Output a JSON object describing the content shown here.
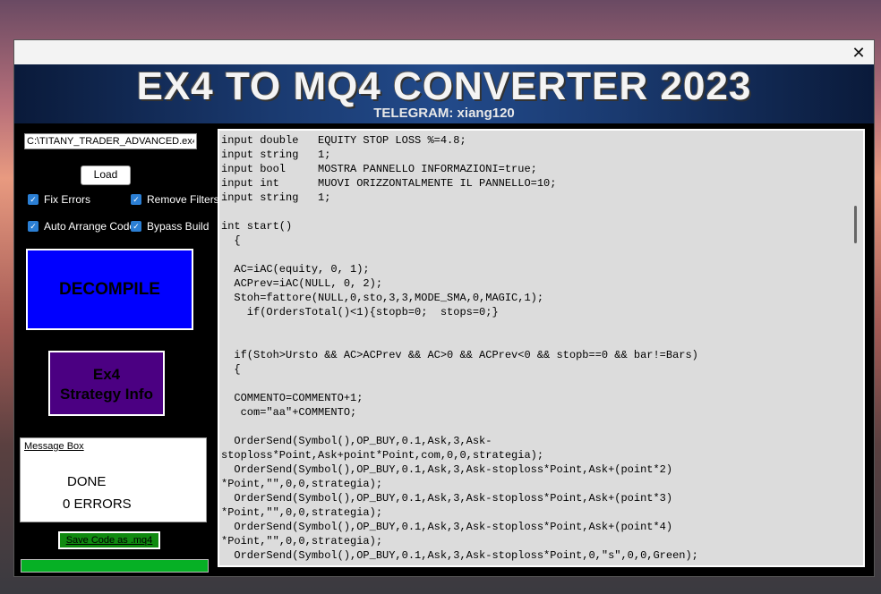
{
  "window": {
    "close_icon": "close-icon"
  },
  "banner": {
    "title": "EX4 TO MQ4 CONVERTER 2023",
    "subtitle": "TELEGRAM: xiang120"
  },
  "file": {
    "path_value": "C:\\TITANY_TRADER_ADVANCED.ex4"
  },
  "buttons": {
    "load": "Load",
    "decompile": "DECOMPILE",
    "strategy_info_line1": "Ex4",
    "strategy_info_line2": "Strategy Info",
    "save": "Save Code as .mq4"
  },
  "options": {
    "fix_errors": "Fix Errors",
    "remove_filters": "Remove Filters",
    "auto_arrange": "Auto Arrange Code",
    "bypass_build": "Bypass Build"
  },
  "message_box": {
    "title": "Message Box",
    "line1": "DONE",
    "line2": "0 ERRORS"
  },
  "progress": {
    "value": 1.0
  },
  "colors": {
    "decompile": "#0000ff",
    "strategy_info": "#4b0082",
    "save": "#108a10",
    "progress": "#06b025",
    "checkbox": "#2b7fd4"
  },
  "code": {
    "text": "input double   EQUITY STOP LOSS %=4.8;\ninput string   1;\ninput bool     MOSTRA PANNELLO INFORMAZIONI=true;\ninput int      MUOVI ORIZZONTALMENTE IL PANNELLO=10;\ninput string   1;\n\nint start()\n  {\n\n  AC=iAC(equity, 0, 1);\n  ACPrev=iAC(NULL, 0, 2);\n  Stoh=fattore(NULL,0,sto,3,3,MODE_SMA,0,MAGIC,1);\n    if(OrdersTotal()<1){stopb=0;  stops=0;}\n\n\n  if(Stoh>Ursto && AC>ACPrev && AC>0 && ACPrev<0 && stopb==0 && bar!=Bars)\n  {\n\n  COMMENTO=COMMENTO+1;\n   com=\"aa\"+COMMENTO;\n\n  OrderSend(Symbol(),OP_BUY,0.1,Ask,3,Ask-\nstoploss*Point,Ask+point*Point,com,0,0,strategia);\n  OrderSend(Symbol(),OP_BUY,0.1,Ask,3,Ask-stoploss*Point,Ask+(point*2)\n*Point,\"\",0,0,strategia);\n  OrderSend(Symbol(),OP_BUY,0.1,Ask,3,Ask-stoploss*Point,Ask+(point*3)\n*Point,\"\",0,0,strategia);\n  OrderSend(Symbol(),OP_BUY,0.1,Ask,3,Ask-stoploss*Point,Ask+(point*4)\n*Point,\"\",0,0,strategia);\n  OrderSend(Symbol(),OP_BUY,0.1,Ask,3,Ask-stoploss*Point,0,\"s\",0,0,Green);"
  }
}
